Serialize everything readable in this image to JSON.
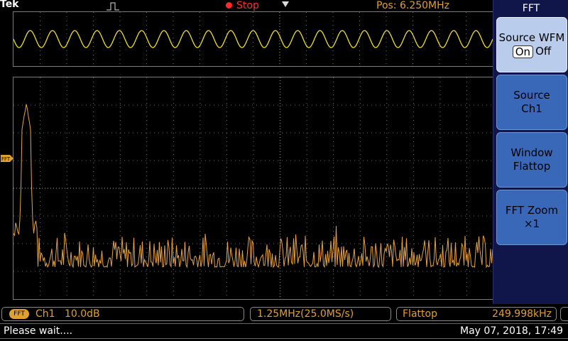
{
  "header": {
    "brand": "Tek",
    "run_status": "Stop",
    "position": "Pos: 6.250MHz"
  },
  "side_menu": {
    "title": "FFT",
    "source_wfm": {
      "label": "Source WFM",
      "on": "On",
      "off": "Off"
    },
    "source": {
      "label": "Source",
      "value": "Ch1"
    },
    "window": {
      "label": "Window",
      "value": "Flattop"
    },
    "fft_zoom": {
      "label": "FFT Zoom",
      "value": "×1"
    }
  },
  "markers": {
    "fft": "FFT"
  },
  "bottom": {
    "fft_badge": "FFT",
    "channel": "Ch1",
    "scale": "10.0dB",
    "span": "1.25MHz(25.0MS/s)",
    "window": "Flattop",
    "frequency": "249.998kHz"
  },
  "status": {
    "message": "Please wait....",
    "datetime": "May 07, 2018, 17:49"
  },
  "colors": {
    "source_trace": "#f0e020",
    "fft_trace": "#e8a040",
    "accent": "#e0a030",
    "menu_bg": "#11164a",
    "button_blue": "#3a68b8",
    "button_selected": "#b9ccec"
  }
}
